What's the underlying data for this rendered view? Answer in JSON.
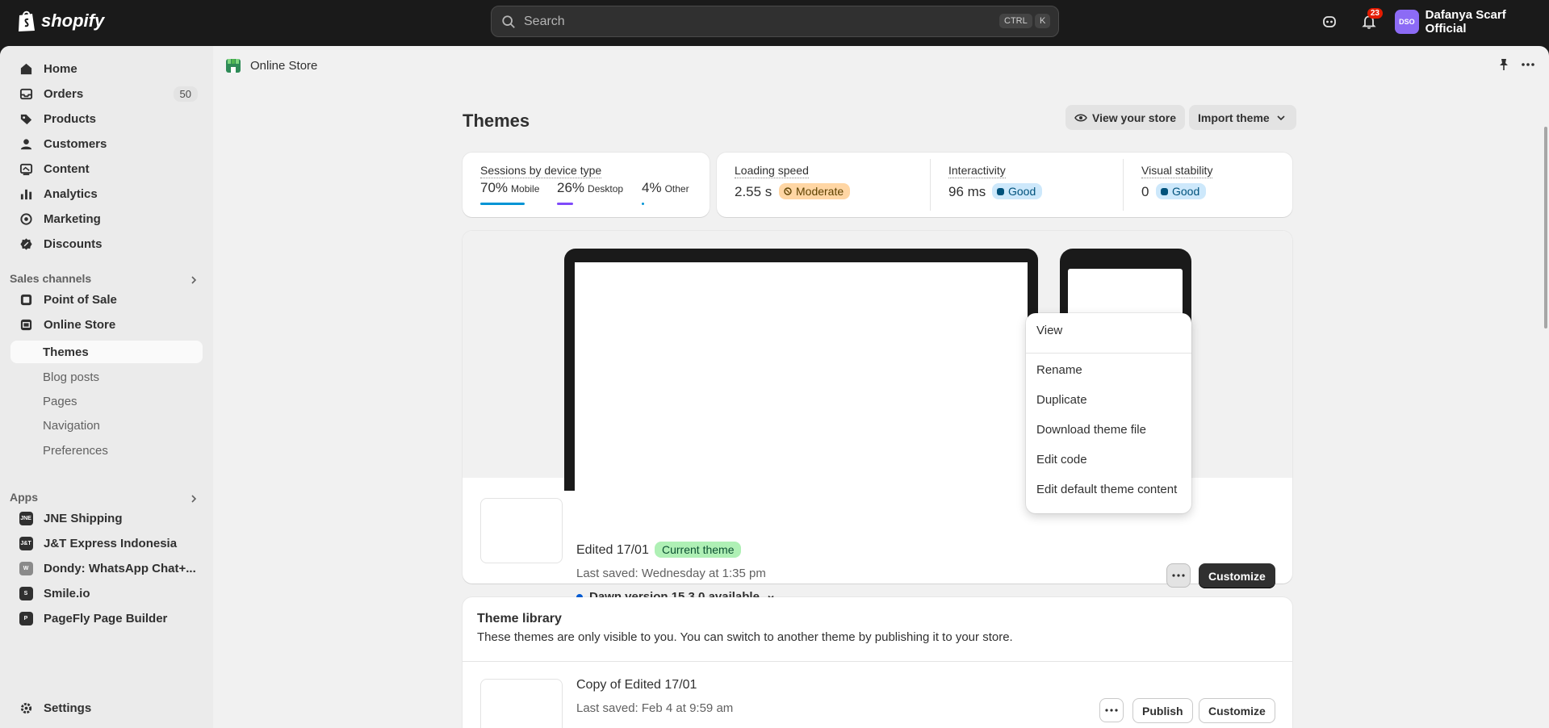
{
  "topbar": {
    "brand": "shopify",
    "search_placeholder": "Search",
    "kbd_ctrl": "CTRL",
    "kbd_k": "K",
    "notification_count": "23",
    "avatar_initials": "DSO",
    "store_name": "Dafanya Scarf Official"
  },
  "sidebar": {
    "main": [
      {
        "label": "Home",
        "icon": "home-icon"
      },
      {
        "label": "Orders",
        "icon": "orders-icon",
        "count": "50"
      },
      {
        "label": "Products",
        "icon": "tag-icon"
      },
      {
        "label": "Customers",
        "icon": "person-icon"
      },
      {
        "label": "Content",
        "icon": "content-icon"
      },
      {
        "label": "Analytics",
        "icon": "chart-icon"
      },
      {
        "label": "Marketing",
        "icon": "target-icon"
      },
      {
        "label": "Discounts",
        "icon": "discount-icon"
      }
    ],
    "sales_channels_label": "Sales channels",
    "channels": [
      {
        "label": "Point of Sale",
        "icon": "pos-icon"
      },
      {
        "label": "Online Store",
        "icon": "store-icon"
      }
    ],
    "online_store_sub": [
      "Themes",
      "Blog posts",
      "Pages",
      "Navigation",
      "Preferences"
    ],
    "apps_label": "Apps",
    "apps": [
      {
        "label": "JNE Shipping",
        "icon": "jne-icon",
        "abbr": "JNE"
      },
      {
        "label": "J&T Express Indonesia",
        "icon": "jt-icon",
        "abbr": "J&T"
      },
      {
        "label": "Dondy: WhatsApp Chat+...",
        "icon": "whatsapp-icon",
        "abbr": "W"
      },
      {
        "label": "Smile.io",
        "icon": "smile-icon",
        "abbr": "S"
      },
      {
        "label": "PageFly Page Builder",
        "icon": "pagefly-icon",
        "abbr": "P"
      }
    ],
    "settings_label": "Settings"
  },
  "header": {
    "breadcrumb": "Online Store"
  },
  "page": {
    "title": "Themes",
    "view_store_label": "View your store",
    "import_theme_label": "Import theme"
  },
  "metrics": {
    "sessions_label": "Sessions by device type",
    "devices": [
      {
        "pct": "70%",
        "name": "Mobile",
        "share": 0.7,
        "color": "#0094d5"
      },
      {
        "pct": "26%",
        "name": "Desktop",
        "share": 0.26,
        "color": "#7f4afa"
      },
      {
        "pct": "4%",
        "name": "Other",
        "share": 0.04,
        "color": "#0094d5"
      }
    ],
    "loading_label": "Loading speed",
    "loading_value": "2.55 s",
    "loading_status": "Moderate",
    "interactivity_label": "Interactivity",
    "interactivity_value": "96 ms",
    "interactivity_status": "Good",
    "visual_label": "Visual stability",
    "visual_value": "0",
    "visual_status": "Good"
  },
  "current_theme": {
    "name": "Edited 17/01",
    "badge": "Current theme",
    "saved": "Last saved: Wednesday at 1:35 pm",
    "version": "Dawn version 15.3.0 available",
    "customize_label": "Customize"
  },
  "menu": {
    "items": [
      "View",
      "Rename",
      "Duplicate",
      "Download theme file",
      "Edit code",
      "Edit default theme content"
    ]
  },
  "library": {
    "title": "Theme library",
    "description": "These themes are only visible to you. You can switch to another theme by publishing it to your store.",
    "themes": [
      {
        "name": "Copy of Edited 17/01",
        "saved": "Last saved: Feb 4 at 9:59 am",
        "publish_label": "Publish",
        "customize_label": "Customize"
      }
    ]
  },
  "colors": {
    "topbar_bg": "#1a1a1a",
    "page_bg": "#f1f1f1",
    "good_badge": "#cde8fb",
    "moderate_badge": "#ffd6a4",
    "current_badge": "#aff0b5"
  }
}
